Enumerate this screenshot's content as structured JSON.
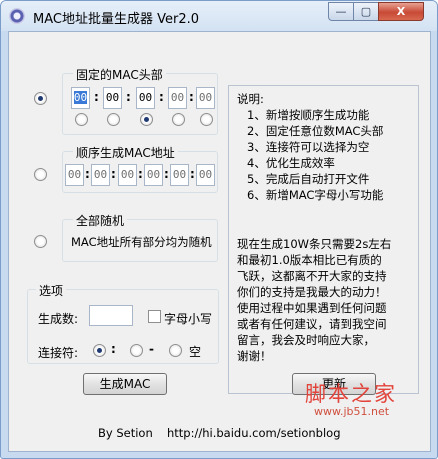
{
  "window": {
    "title": "MAC地址批量生成器 Ver2.0",
    "controls": {
      "minimize": "—",
      "maximize": "▢",
      "close": "X"
    }
  },
  "fixed_prefix": {
    "title": "固定的MAC头部",
    "selected": true,
    "octets": [
      "00",
      "00",
      "00",
      "00",
      "00",
      "00"
    ],
    "separator": ":",
    "selected_octet_radio": 2
  },
  "sequential": {
    "title": "顺序生成MAC地址",
    "selected": false,
    "octets": [
      "00",
      "00",
      "00",
      "00",
      "00",
      "00"
    ],
    "separator": ":"
  },
  "random": {
    "title": "全部随机",
    "selected": false,
    "description": "MAC地址所有部分均为随机"
  },
  "options": {
    "title": "选项",
    "count_label": "生成数:",
    "count_value": "",
    "lowercase_label": "字母小写",
    "lowercase_checked": false,
    "joiner_label": "连接符:",
    "joiners": [
      {
        "label": ":",
        "selected": true
      },
      {
        "label": "-",
        "selected": false
      },
      {
        "label": "空",
        "selected": false
      }
    ]
  },
  "info": {
    "lines": [
      "说明:",
      "  1、新增按顺序生成功能",
      "  2、固定任意位数MAC头部",
      "  3、连接符可以选择为空",
      "  4、优化生成效率",
      "  5、完成后自动打开文件",
      "  6、新增MAC字母小写功能"
    ],
    "paragraph": [
      "现在生成10W条只需要2s左右",
      "和最初1.0版本相比已有质的",
      "飞跃，这都离不开大家的支持",
      "你们的支持是我最大的动力！",
      "使用过程中如果遇到任何问题",
      "或者有任何建议，请到我空间",
      "留言，我会及时响应大家，",
      "谢谢！"
    ]
  },
  "buttons": {
    "generate": "生成MAC",
    "update": "更新"
  },
  "footer": {
    "author": "By Setion",
    "url": "http://hi.baidu.com/setionblog"
  },
  "watermark": {
    "text": "脚本之家",
    "url": "www.jb51.net"
  },
  "colors": {
    "accent": "#3a79d6",
    "window_frame": "#c7daf0",
    "watermark": "#e2433a"
  }
}
